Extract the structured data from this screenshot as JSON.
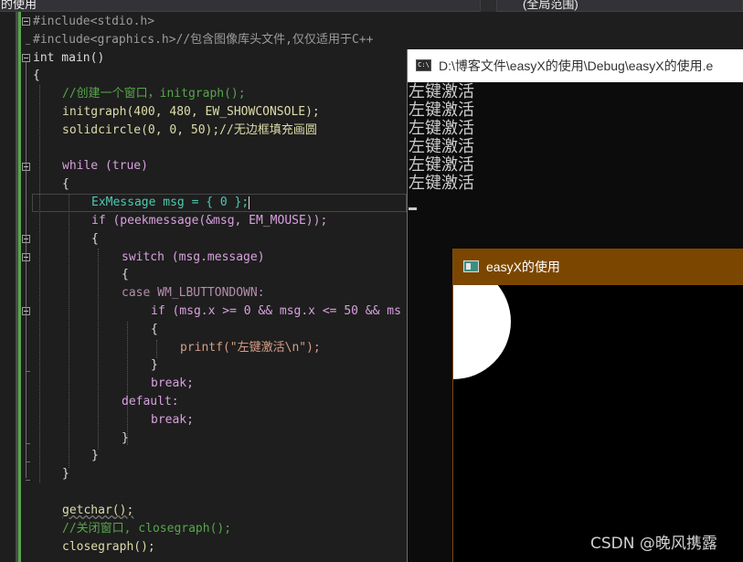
{
  "topbar": {
    "scope_left": "的使用",
    "scope_right": "(全局范围)"
  },
  "code": {
    "lines": [
      "#include<stdio.h>",
      "#include<graphics.h>//包含图像库头文件,仅仅适用于C++",
      "int main()",
      "{",
      "//创建一个窗口，initgraph();",
      "initgraph(400, 480, EW_SHOWCONSOLE);",
      "solidcircle(0, 0, 50);//无边框填充画圆",
      "while (true)",
      "{",
      "ExMessage msg = { 0 };",
      "if (peekmessage(&msg, EM_MOUSE));",
      "{",
      "switch (msg.message)",
      "{",
      "case WM_LBUTTONDOWN:",
      "if (msg.x >= 0 && msg.x <= 50 && ms",
      "{",
      "printf(\"左键激活\\n\");",
      "}",
      "break;",
      "default:",
      "break;",
      "}",
      "}",
      "}",
      "getchar();",
      "//关闭窗口, closegraph();",
      "closegraph();"
    ]
  },
  "console": {
    "icon_label": "C:\\",
    "title": "D:\\博客文件\\easyX的使用\\Debug\\easyX的使用.e",
    "output": [
      "左键激活",
      "左键激活",
      "左键激活",
      "左键激活",
      "左键激活",
      "左键激活"
    ]
  },
  "easyx": {
    "title": "easyX的使用"
  },
  "watermark": "CSDN @晚风携露",
  "colors": {
    "editor_bg": "#1e1e1e",
    "keyword": "#569cd6",
    "control": "#d8a0df",
    "type": "#4ec9b0",
    "function": "#dcdcaa",
    "macro": "#b48ead",
    "comment": "#57a64a",
    "easyx_titlebar": "#7b4700"
  }
}
